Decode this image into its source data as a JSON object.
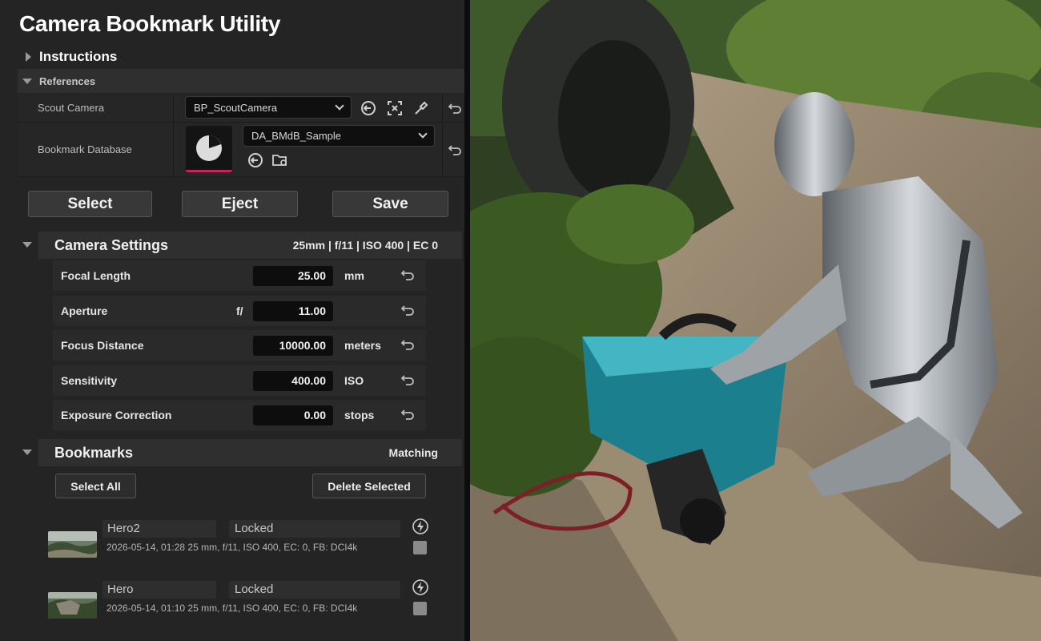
{
  "app": {
    "title": "Camera Bookmark Utility"
  },
  "instructions": {
    "label": "Instructions"
  },
  "references": {
    "label": "References",
    "scout_camera": {
      "label": "Scout Camera",
      "value": "BP_ScoutCamera",
      "icons": [
        "browse-to-asset-icon",
        "select-actor-icon",
        "eyedropper-icon",
        "reset-icon"
      ]
    },
    "bookmark_database": {
      "label": "Bookmark Database",
      "value": "DA_BMdB_Sample",
      "icons": [
        "browse-to-asset-icon",
        "browse-folder-icon",
        "reset-icon"
      ]
    }
  },
  "actions": {
    "select": "Select",
    "eject": "Eject",
    "save": "Save"
  },
  "camera_settings": {
    "label": "Camera Settings",
    "summary": "25mm | f/11 | ISO 400 | EC 0",
    "rows": [
      {
        "name": "Focal Length",
        "prefix": "",
        "value": "25.00",
        "unit": "mm"
      },
      {
        "name": "Aperture",
        "prefix": "f/",
        "value": "11.00",
        "unit": ""
      },
      {
        "name": "Focus Distance",
        "prefix": "",
        "value": "10000.00",
        "unit": "meters"
      },
      {
        "name": "Sensitivity",
        "prefix": "",
        "value": "400.00",
        "unit": "ISO"
      },
      {
        "name": "Exposure Correction",
        "prefix": "",
        "value": "0.00",
        "unit": "stops"
      }
    ]
  },
  "bookmarks": {
    "label": "Bookmarks",
    "status": "Matching",
    "select_all": "Select All",
    "delete_selected": "Delete Selected",
    "items": [
      {
        "name": "Hero2",
        "state": "Locked",
        "meta": "2026-05-14, 01:28   25 mm, f/11, ISO 400, EC: 0, FB: DCI4k"
      },
      {
        "name": "Hero",
        "state": "Locked",
        "meta": "2026-05-14, 01:10   25 mm, f/11, ISO 400, EC: 0, FB: DCI4k"
      }
    ]
  },
  "colors": {
    "panel_bg": "#242424",
    "accent_pink": "#c3255e",
    "field_bg": "#0d0d0d"
  }
}
